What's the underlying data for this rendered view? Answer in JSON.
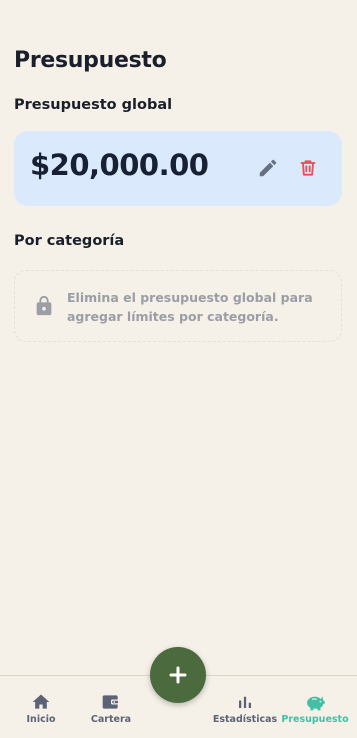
{
  "header": {
    "title": "Presupuesto"
  },
  "global_budget": {
    "section_title": "Presupuesto global",
    "amount": "$20,000.00",
    "edit_icon": "pencil-icon",
    "delete_icon": "trash-icon",
    "colors": {
      "card_bg": "#dbe9fd",
      "delete": "#ef4b57"
    }
  },
  "category_budget": {
    "section_title": "Por categoría",
    "locked_message": "Elimina el presupuesto global para agregar límites por categoría.",
    "icon": "lock-icon"
  },
  "nav": {
    "items": [
      {
        "label": "Inicio",
        "icon": "home-icon"
      },
      {
        "label": "Cartera",
        "icon": "wallet-icon"
      },
      {
        "label": "Estadísticas",
        "icon": "bar-chart-icon"
      },
      {
        "label": "Presupuesto",
        "icon": "piggy-bank-icon",
        "active": true
      }
    ],
    "fab_icon": "plus-icon",
    "colors": {
      "active": "#43bfa6",
      "fab": "#4b6b3f"
    }
  }
}
